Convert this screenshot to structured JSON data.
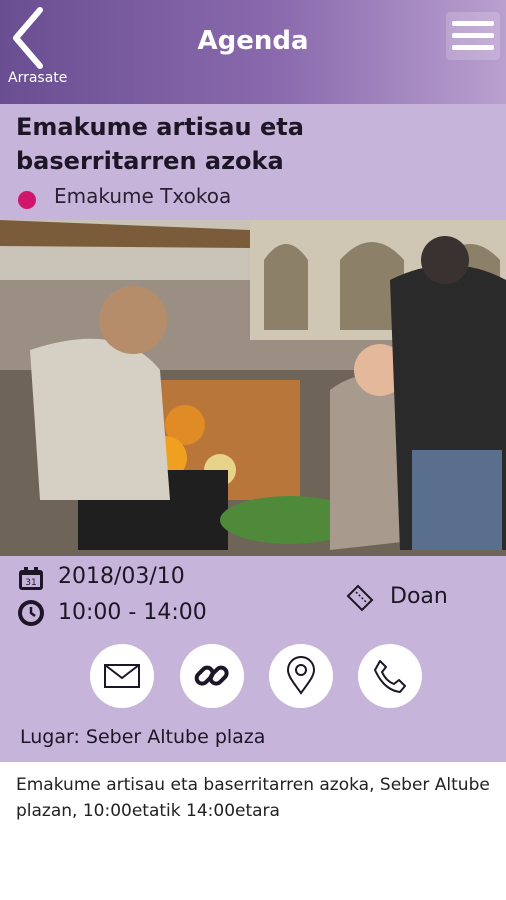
{
  "header": {
    "title": "Agenda",
    "back_label": "Arrasate",
    "back_icon": "chevron-left-icon",
    "menu_icon": "hamburger-icon"
  },
  "event": {
    "title": "Emakume artisau eta baserritarren azoka",
    "category": "Emakume Txokoa",
    "category_color": "#d1156d",
    "image_alt": "market photo"
  },
  "details": {
    "date": "2018/03/10",
    "time": "10:00 - 14:00",
    "price": "Doan",
    "place": "Lugar: Seber Altube plaza"
  },
  "actions": [
    {
      "icon": "mail-icon"
    },
    {
      "icon": "link-icon"
    },
    {
      "icon": "location-pin-icon"
    },
    {
      "icon": "phone-icon"
    }
  ],
  "description": "Emakume artisau eta baserritarren azoka, Seber Altube plazan, 10:00etatik 14:00etara",
  "colors": {
    "header_start": "#6a4e92",
    "header_end": "#b9a0cf",
    "panel": "#c7b4da"
  }
}
